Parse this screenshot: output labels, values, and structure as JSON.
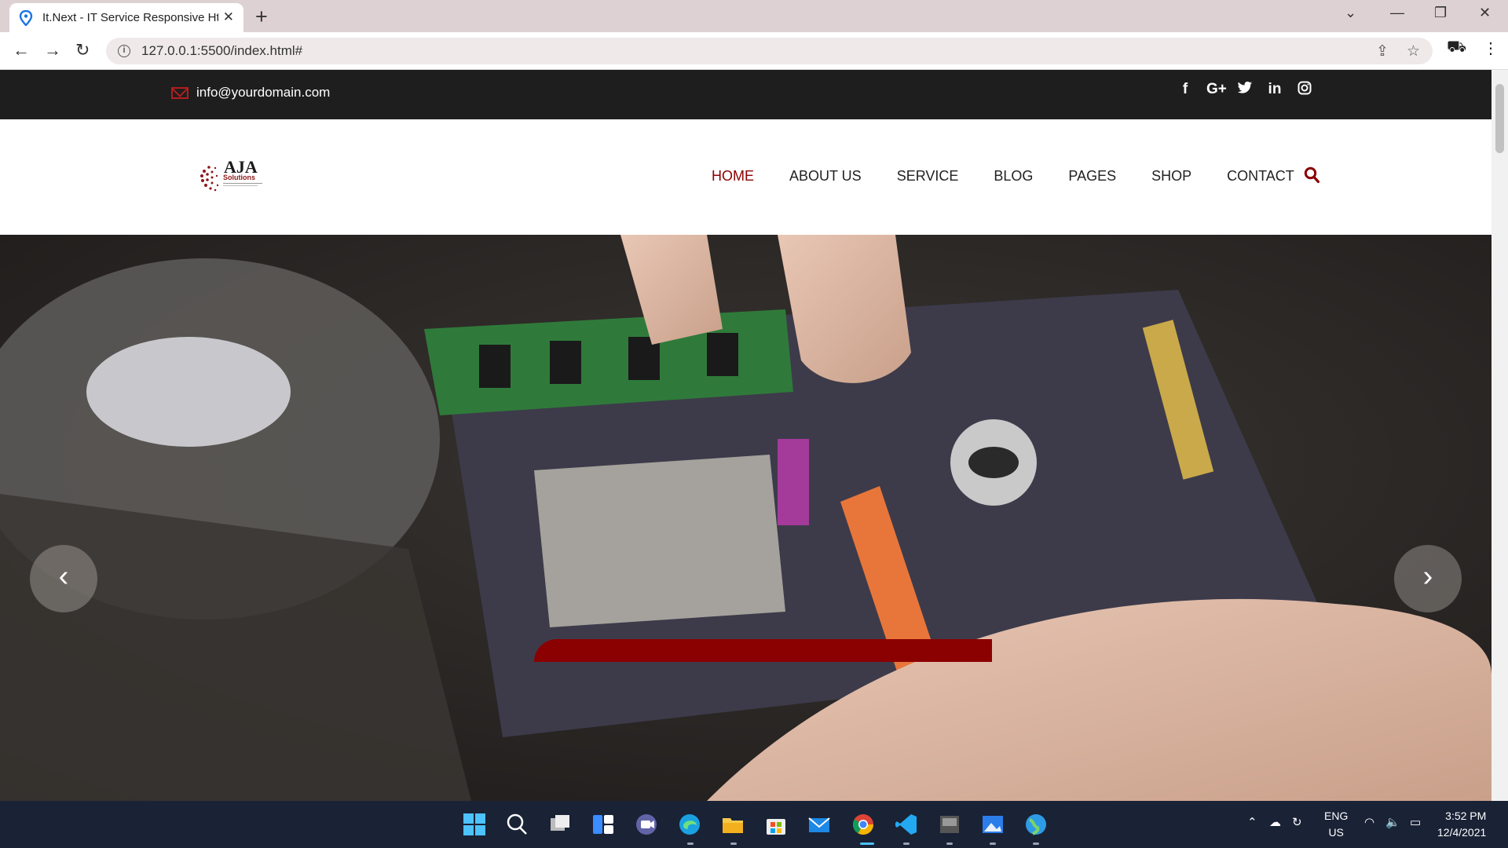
{
  "browser": {
    "tab_title": "It.Next - IT Service Responsive Ht",
    "url": "127.0.0.1:5500/index.html#"
  },
  "site": {
    "email": "info@yourdomain.com",
    "socials": [
      "f",
      "G+",
      "t",
      "in",
      "ig"
    ],
    "logo_text": "AJA",
    "logo_sub": "Solutions",
    "nav": [
      "HOME",
      "ABOUT US",
      "SERVICE",
      "BLOG",
      "PAGES",
      "SHOP",
      "CONTACT"
    ],
    "active_nav": "HOME",
    "accent_color": "#8b0000"
  },
  "taskbar": {
    "lang_line1": "ENG",
    "lang_line2": "US",
    "time": "3:52 PM",
    "date": "12/4/2021"
  }
}
